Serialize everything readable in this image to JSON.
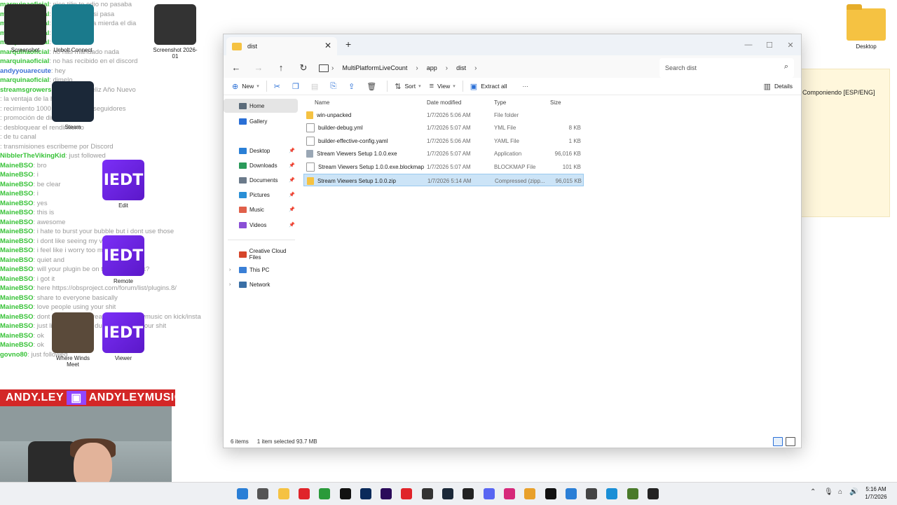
{
  "chat": [
    {
      "user": "marquinaoficial",
      "msg": "nice tilin te odio no pasaba",
      "blue": false
    },
    {
      "user": "marquinaoficial",
      "msg": "puta te odio asi pasa",
      "blue": false
    },
    {
      "user": "marquinaoficial",
      "msg": "que se caga la mierda el dia",
      "blue": false
    },
    {
      "user": "marquinaoficial",
      "msg": "wasap bro",
      "blue": false
    },
    {
      "user": "marquinaoficial",
      "msg": "dimelo",
      "blue": false
    },
    {
      "user": "marquinaoficial",
      "msg": "no has mandado nada",
      "blue": false
    },
    {
      "user": "marquinaoficial",
      "msg": "no has recibido en el discord",
      "blue": false
    },
    {
      "user": "andyyouarecute",
      "msg": "hey",
      "blue": true
    },
    {
      "user": "marquinaoficial",
      "msg": "dimelo",
      "blue": false
    },
    {
      "user": "streamsgrowers",
      "msg": "hola amigo feliz Año Nuevo",
      "blue": false
    },
    {
      "user": "",
      "msg": "la ventaja de la herramienta",
      "blue": false
    },
    {
      "user": "",
      "msg": "recimiento 1000 mas de 1500 seguidores",
      "blue": false
    },
    {
      "user": "",
      "msg": "promoción de directo",
      "blue": false
    },
    {
      "user": "",
      "msg": "desbloquear el rendimiento",
      "blue": false
    },
    {
      "user": "",
      "msg": "de tu canal",
      "blue": false
    },
    {
      "user": "",
      "msg": "transmisiones escribeme por Discord",
      "blue": false
    },
    {
      "user": "NibblerTheVikingKid",
      "msg": "just followed",
      "blue": false
    },
    {
      "user": "MaineBSO",
      "msg": "bro",
      "blue": false
    },
    {
      "user": "MaineBSO",
      "msg": "i",
      "blue": false
    },
    {
      "user": "MaineBSO",
      "msg": "be clear",
      "blue": false
    },
    {
      "user": "MaineBSO",
      "msg": "i",
      "blue": false
    },
    {
      "user": "MaineBSO",
      "msg": "yes",
      "blue": false
    },
    {
      "user": "MaineBSO",
      "msg": "this is",
      "blue": false
    },
    {
      "user": "MaineBSO",
      "msg": "awesome",
      "blue": false
    },
    {
      "user": "MaineBSO",
      "msg": "i hate to burst your bubble but i dont use those",
      "blue": false
    },
    {
      "user": "MaineBSO",
      "msg": "i dont like seeing my viewers",
      "blue": false
    },
    {
      "user": "MaineBSO",
      "msg": "i feel like i worry too much",
      "blue": false
    },
    {
      "user": "MaineBSO",
      "msg": "quiet and",
      "blue": false
    },
    {
      "user": "MaineBSO",
      "msg": "will your plugin be on to make it work?",
      "blue": false
    },
    {
      "user": "MaineBSO",
      "msg": "i got it",
      "blue": false
    },
    {
      "user": "MaineBSO",
      "msg": "here https://obsproject.com/forum/list/plugins.8/",
      "blue": false
    },
    {
      "user": "MaineBSO",
      "msg": "share to everyone basically",
      "blue": false
    },
    {
      "user": "MaineBSO",
      "msg": "love people using your shit",
      "blue": false
    },
    {
      "user": "MaineBSO",
      "msg": "dont forget to but created by andyleymusic on kick/insta",
      "blue": false
    },
    {
      "user": "MaineBSO",
      "msg": "just like them other dudes promote your shit",
      "blue": false
    },
    {
      "user": "MaineBSO",
      "msg": "ok",
      "blue": false
    },
    {
      "user": "MaineBSO",
      "msg": "ok",
      "blue": false
    },
    {
      "user": "govno80",
      "msg": "just followed",
      "blue": false
    }
  ],
  "desktop_icons": [
    {
      "label": "Screenshot",
      "id": "screenshot-1"
    },
    {
      "label": "Unbolt Connect",
      "id": "unbolt"
    },
    {
      "label": "Screenshot 2026-01",
      "id": "screenshot-2"
    },
    {
      "label": "Steam",
      "id": "steam"
    },
    {
      "label": "Edit",
      "id": "iedt-edit",
      "iedt": "IEDT"
    },
    {
      "label": "Remote",
      "id": "iedt-remote",
      "iedt": "IEDT"
    },
    {
      "label": "Viewer",
      "id": "iedt-viewer",
      "iedt": "IEDT"
    },
    {
      "label": "Where Winds Meet",
      "id": "wwm"
    }
  ],
  "banner": {
    "left": "ANDY.LEY",
    "right": "ANDYLEYMUSIC"
  },
  "right_folder": {
    "label": "Desktop"
  },
  "side_panel": {
    "text": "Componiendo [ESP/ENG]"
  },
  "window": {
    "tab_title": "dist",
    "breadcrumbs": [
      "MultiPlatformLiveCount",
      "app",
      "dist"
    ],
    "search_placeholder": "Search dist",
    "toolbar": {
      "new": "New",
      "sort": "Sort",
      "view": "View",
      "extract_all": "Extract all",
      "more": "···",
      "details": "Details"
    },
    "nav": [
      {
        "label": "Home",
        "icon": "home-icon",
        "sel": true,
        "pin": false,
        "chev": false
      },
      {
        "label": "Gallery",
        "icon": "gallery-icon",
        "sel": false,
        "pin": false,
        "chev": false
      },
      {
        "label": "Desktop",
        "icon": "desktop-icon",
        "sel": false,
        "pin": true,
        "chev": false
      },
      {
        "label": "Downloads",
        "icon": "downloads-icon",
        "sel": false,
        "pin": true,
        "chev": false
      },
      {
        "label": "Documents",
        "icon": "documents-icon",
        "sel": false,
        "pin": true,
        "chev": false
      },
      {
        "label": "Pictures",
        "icon": "pictures-icon",
        "sel": false,
        "pin": true,
        "chev": false
      },
      {
        "label": "Music",
        "icon": "music-icon",
        "sel": false,
        "pin": true,
        "chev": false
      },
      {
        "label": "Videos",
        "icon": "videos-icon",
        "sel": false,
        "pin": true,
        "chev": false
      },
      {
        "label": "Creative Cloud Files",
        "icon": "creative-cloud-icon",
        "sel": false,
        "pin": false,
        "chev": false
      },
      {
        "label": "This PC",
        "icon": "this-pc-icon",
        "sel": false,
        "pin": false,
        "chev": true
      },
      {
        "label": "Network",
        "icon": "network-icon",
        "sel": false,
        "pin": false,
        "chev": true
      }
    ],
    "columns": {
      "name": "Name",
      "date": "Date modified",
      "type": "Type",
      "size": "Size"
    },
    "files": [
      {
        "name": "win-unpacked",
        "date": "1/7/2026 5:06 AM",
        "type": "File folder",
        "size": "",
        "icon": "folder-icon",
        "sel": false
      },
      {
        "name": "builder-debug.yml",
        "date": "1/7/2026 5:07 AM",
        "type": "YML File",
        "size": "8 KB",
        "icon": "file-icon",
        "sel": false
      },
      {
        "name": "builder-effective-config.yaml",
        "date": "1/7/2026 5:06 AM",
        "type": "YAML File",
        "size": "1 KB",
        "icon": "file-icon",
        "sel": false
      },
      {
        "name": "Stream Viewers Setup 1.0.0.exe",
        "date": "1/7/2026 5:07 AM",
        "type": "Application",
        "size": "96,016 KB",
        "icon": "app-icon",
        "sel": false
      },
      {
        "name": "Stream Viewers Setup 1.0.0.exe.blockmap",
        "date": "1/7/2026 5:07 AM",
        "type": "BLOCKMAP File",
        "size": "101 KB",
        "icon": "file-icon",
        "sel": false
      },
      {
        "name": "Stream Viewers Setup 1.0.0.zip",
        "date": "1/7/2026 5:14 AM",
        "type": "Compressed (zipp...",
        "size": "96,015 KB",
        "icon": "zip-folder-icon",
        "sel": true
      }
    ],
    "status": {
      "count": "6 items",
      "selected": "1 item selected  93.7 MB"
    }
  },
  "taskbar": {
    "apps": [
      "start-icon",
      "search-icon",
      "file-explorer-icon",
      "opera-icon",
      "xbox-icon",
      "capcut-icon",
      "photoshop-icon",
      "premiere-icon",
      "youtube-icon",
      "epic-games-icon",
      "steam-icon",
      "github-icon",
      "discord-icon",
      "instagram-icon",
      "chrome-icon",
      "tiktok-icon",
      "vscode-icon",
      "obs-icon",
      "edge-icon",
      "minecraft-icon",
      "terminal-icon"
    ],
    "time": "5:16 AM",
    "date": "1/7/2026"
  },
  "colors": {
    "accent": "#2a6fd6",
    "selection": "#cce4f7",
    "iedt": "#6a23e0",
    "chat_user": "#37c237"
  }
}
